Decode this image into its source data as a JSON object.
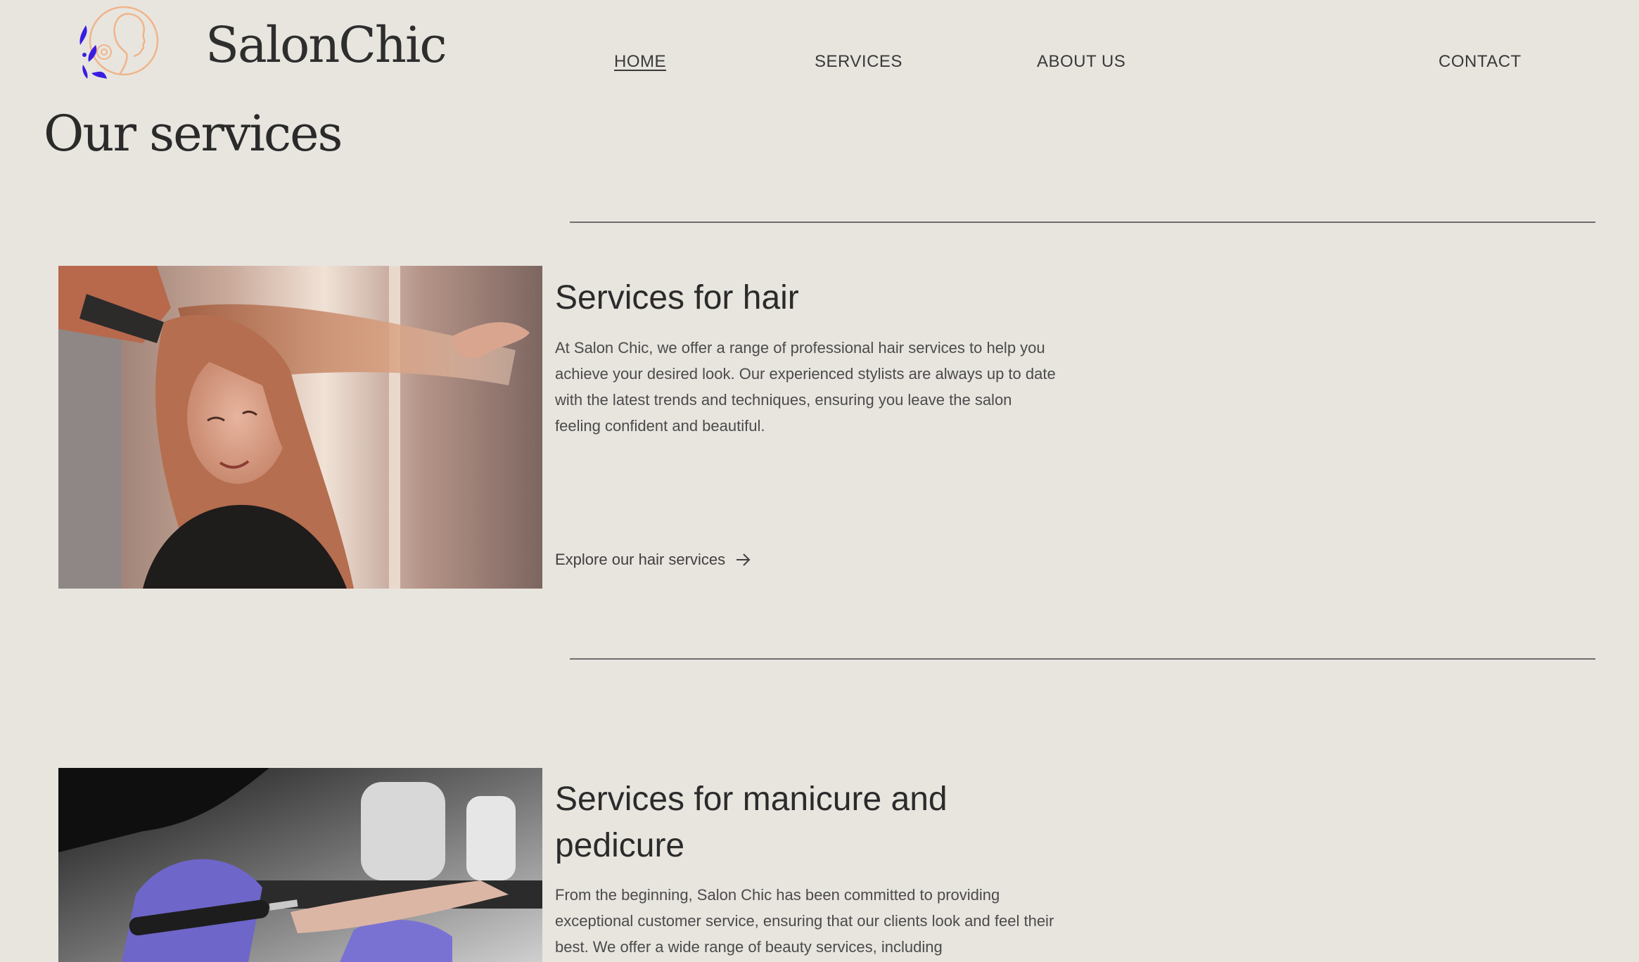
{
  "header": {
    "brand": "SalonChic",
    "logo_icon": "woman-profile-with-leaves-logo"
  },
  "nav": {
    "items": [
      {
        "label": "HOME",
        "active": true
      },
      {
        "label": "SERVICES",
        "active": false
      },
      {
        "label": "ABOUT US",
        "active": false
      },
      {
        "label": "CONTACT",
        "active": false
      }
    ]
  },
  "page": {
    "title": "Our services"
  },
  "services": [
    {
      "title": "Services for hair",
      "description": "At Salon Chic, we offer a range of professional hair services to help you achieve your desired look. Our experienced stylists are always up to date with the latest trends and techniques, ensuring you leave the salon feeling confident and beautiful.",
      "link_label": "Explore our hair services",
      "link_icon": "arrow-right-icon",
      "image": "woman-hair-styling-photo"
    },
    {
      "title": "Services for manicure and pedicure",
      "description": "From the beginning, Salon Chic has been committed to providing exceptional customer service, ensuring that our clients look and feel their best. We offer a wide range of beauty services, including",
      "image": "manicure-nail-drill-photo"
    }
  ],
  "colors": {
    "background": "#e8e5df",
    "text": "#2b2b2b",
    "logo_peach": "#f0b48a",
    "logo_violet": "#3a1de0"
  }
}
